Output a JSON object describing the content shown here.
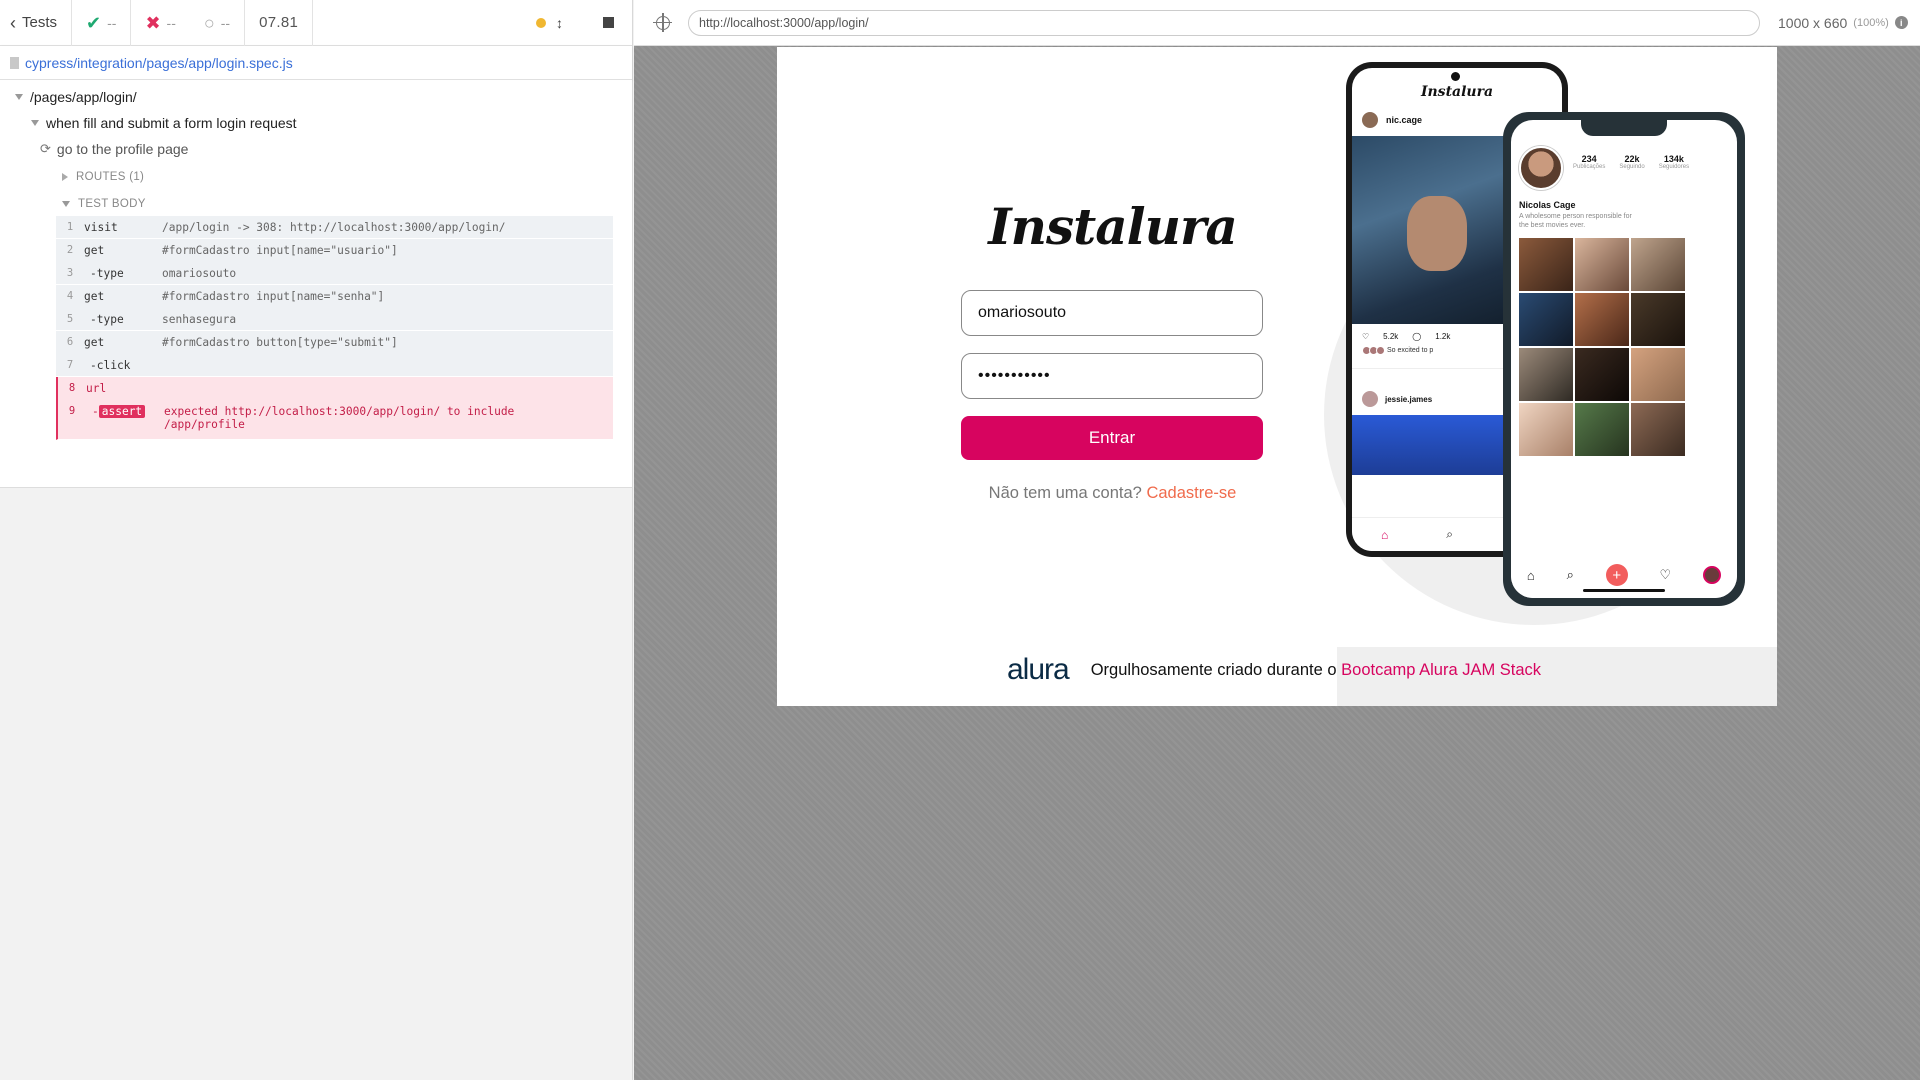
{
  "reporter": {
    "tests_label": "Tests",
    "passed": "--",
    "failed": "--",
    "pending": "--",
    "duration": "07.81",
    "spec_path": "cypress/integration/pages/app/login.spec.js",
    "suite_root": "/pages/app/login/",
    "suite_child": "when fill and submit a form login request",
    "test_title": "go to the profile page",
    "routes_label": "ROUTES (1)",
    "test_body_label": "TEST BODY",
    "commands": [
      {
        "num": "1",
        "name": "visit",
        "msg": "/app/login -> 308: http://localhost:3000/app/login/"
      },
      {
        "num": "2",
        "name": "get",
        "msg": "#formCadastro input[name=\"usuario\"]"
      },
      {
        "num": "3",
        "name": "-type",
        "msg": "omariosouto"
      },
      {
        "num": "4",
        "name": "get",
        "msg": "#formCadastro input[name=\"senha\"]"
      },
      {
        "num": "5",
        "name": "-type",
        "msg": "senhasegura"
      },
      {
        "num": "6",
        "name": "get",
        "msg": "#formCadastro button[type=\"submit\"]"
      },
      {
        "num": "7",
        "name": "-click",
        "msg": ""
      },
      {
        "num": "8",
        "name": "url",
        "msg": ""
      }
    ],
    "assert_row": {
      "num": "9",
      "badge": "assert",
      "expected_label": "expected",
      "url": "http://localhost:3000/app/login/",
      "include_label": "to include",
      "target": "/app/profile"
    }
  },
  "aut": {
    "url": "http://localhost:3000/app/login/",
    "viewport": "1000 x 660",
    "zoom": "(100%)"
  },
  "app": {
    "logo": "Instalura",
    "username_value": "omariosouto",
    "password_value": "•••••••••••",
    "submit_label": "Entrar",
    "signup_prompt": "Não tem uma conta?",
    "signup_link": "Cadastre-se",
    "footer_logo": "alura",
    "footer_text": "Orgulhosamente criado durante o",
    "footer_link": "Bootcamp Alura JAM Stack",
    "phone_back": {
      "title": "Instalura",
      "user": "nic.cage",
      "likes": "5.2k",
      "comments": "1.2k",
      "caption": "So excited to p",
      "user2": "jessie.james"
    },
    "phone_front": {
      "posts": "234",
      "posts_label": "Publicações",
      "following": "22k",
      "following_label": "Seguindo",
      "followers": "134k",
      "followers_label": "Seguidores",
      "name": "Nicolas Cage",
      "bio": "A wholesome person responsible for the best movies ever."
    }
  },
  "colors": {
    "accent": "#d7045f",
    "signup_link": "#f06b4c",
    "fail": "#e0305e"
  }
}
